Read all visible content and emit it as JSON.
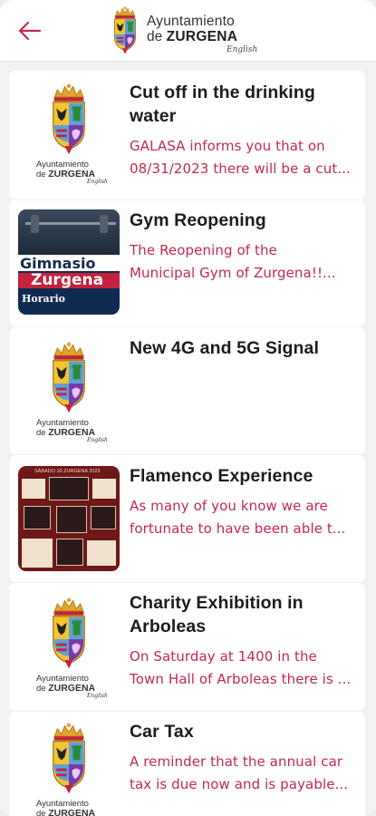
{
  "header": {
    "logo_line1": "Ayuntamiento",
    "logo_line2_prefix": "de",
    "logo_line2_bold": "ZURGENA",
    "logo_line3": "English",
    "back_icon": "arrow-left-icon"
  },
  "thumb_logo": {
    "line1": "Ayuntamiento",
    "line2_prefix": "de",
    "line2_bold": "ZURGENA",
    "line3": "English"
  },
  "gym_poster": {
    "line1": "Gimnasio",
    "line2": "Zurgena",
    "line3": "Horario"
  },
  "flamenco_poster": {
    "header": "SÁBADO 10 ZURGENA 2023"
  },
  "colors": {
    "accent": "#c22a4c",
    "title": "#1c1c1c",
    "background": "#f3f2f2"
  },
  "news": [
    {
      "title_lines": [
        "Cut off in the drinking",
        "water"
      ],
      "desc_lines": [
        "GALASA informs you that on",
        "08/31/2023 there will be a cut..."
      ]
    },
    {
      "title_lines": [
        "Gym Reopening"
      ],
      "desc_lines": [
        "The Reopening of the",
        "Municipal Gym of Zurgena!!..."
      ]
    },
    {
      "title_lines": [
        "New 4G and 5G Signal"
      ],
      "desc_lines": []
    },
    {
      "title_lines": [
        "Flamenco Experience"
      ],
      "desc_lines": [
        "As many of you know we are",
        "fortunate to have been able t..."
      ]
    },
    {
      "title_lines": [
        "Charity Exhibition in",
        "Arboleas"
      ],
      "desc_lines": [
        "On Saturday at 1400 in the",
        "Town Hall of Arboleas there is ..."
      ]
    },
    {
      "title_lines": [
        "Car Tax"
      ],
      "desc_lines": [
        "A reminder that the annual car",
        "tax is due now and is payable..."
      ]
    }
  ]
}
